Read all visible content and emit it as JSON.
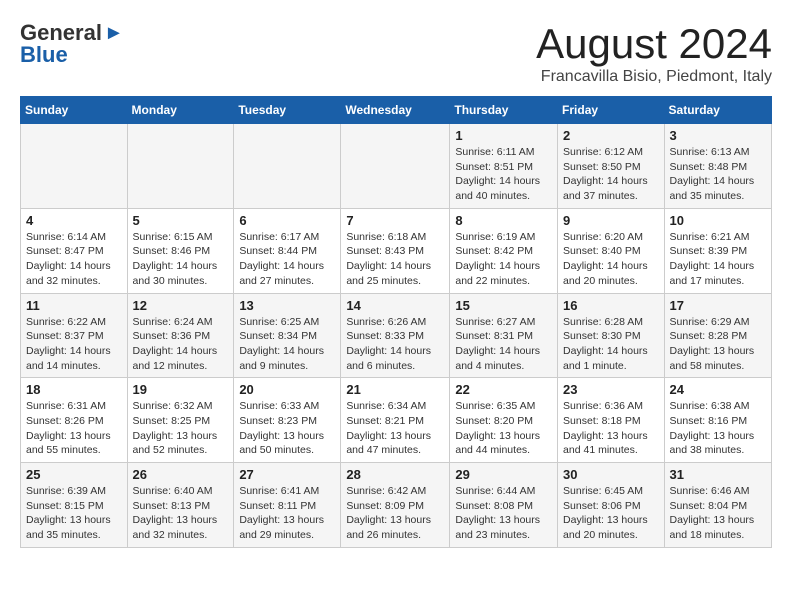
{
  "logo": {
    "general": "General",
    "blue": "Blue"
  },
  "title": "August 2024",
  "location": "Francavilla Bisio, Piedmont, Italy",
  "weekdays": [
    "Sunday",
    "Monday",
    "Tuesday",
    "Wednesday",
    "Thursday",
    "Friday",
    "Saturday"
  ],
  "weeks": [
    [
      {
        "day": "",
        "content": ""
      },
      {
        "day": "",
        "content": ""
      },
      {
        "day": "",
        "content": ""
      },
      {
        "day": "",
        "content": ""
      },
      {
        "day": "1",
        "content": "Sunrise: 6:11 AM\nSunset: 8:51 PM\nDaylight: 14 hours and 40 minutes."
      },
      {
        "day": "2",
        "content": "Sunrise: 6:12 AM\nSunset: 8:50 PM\nDaylight: 14 hours and 37 minutes."
      },
      {
        "day": "3",
        "content": "Sunrise: 6:13 AM\nSunset: 8:48 PM\nDaylight: 14 hours and 35 minutes."
      }
    ],
    [
      {
        "day": "4",
        "content": "Sunrise: 6:14 AM\nSunset: 8:47 PM\nDaylight: 14 hours and 32 minutes."
      },
      {
        "day": "5",
        "content": "Sunrise: 6:15 AM\nSunset: 8:46 PM\nDaylight: 14 hours and 30 minutes."
      },
      {
        "day": "6",
        "content": "Sunrise: 6:17 AM\nSunset: 8:44 PM\nDaylight: 14 hours and 27 minutes."
      },
      {
        "day": "7",
        "content": "Sunrise: 6:18 AM\nSunset: 8:43 PM\nDaylight: 14 hours and 25 minutes."
      },
      {
        "day": "8",
        "content": "Sunrise: 6:19 AM\nSunset: 8:42 PM\nDaylight: 14 hours and 22 minutes."
      },
      {
        "day": "9",
        "content": "Sunrise: 6:20 AM\nSunset: 8:40 PM\nDaylight: 14 hours and 20 minutes."
      },
      {
        "day": "10",
        "content": "Sunrise: 6:21 AM\nSunset: 8:39 PM\nDaylight: 14 hours and 17 minutes."
      }
    ],
    [
      {
        "day": "11",
        "content": "Sunrise: 6:22 AM\nSunset: 8:37 PM\nDaylight: 14 hours and 14 minutes."
      },
      {
        "day": "12",
        "content": "Sunrise: 6:24 AM\nSunset: 8:36 PM\nDaylight: 14 hours and 12 minutes."
      },
      {
        "day": "13",
        "content": "Sunrise: 6:25 AM\nSunset: 8:34 PM\nDaylight: 14 hours and 9 minutes."
      },
      {
        "day": "14",
        "content": "Sunrise: 6:26 AM\nSunset: 8:33 PM\nDaylight: 14 hours and 6 minutes."
      },
      {
        "day": "15",
        "content": "Sunrise: 6:27 AM\nSunset: 8:31 PM\nDaylight: 14 hours and 4 minutes."
      },
      {
        "day": "16",
        "content": "Sunrise: 6:28 AM\nSunset: 8:30 PM\nDaylight: 14 hours and 1 minute."
      },
      {
        "day": "17",
        "content": "Sunrise: 6:29 AM\nSunset: 8:28 PM\nDaylight: 13 hours and 58 minutes."
      }
    ],
    [
      {
        "day": "18",
        "content": "Sunrise: 6:31 AM\nSunset: 8:26 PM\nDaylight: 13 hours and 55 minutes."
      },
      {
        "day": "19",
        "content": "Sunrise: 6:32 AM\nSunset: 8:25 PM\nDaylight: 13 hours and 52 minutes."
      },
      {
        "day": "20",
        "content": "Sunrise: 6:33 AM\nSunset: 8:23 PM\nDaylight: 13 hours and 50 minutes."
      },
      {
        "day": "21",
        "content": "Sunrise: 6:34 AM\nSunset: 8:21 PM\nDaylight: 13 hours and 47 minutes."
      },
      {
        "day": "22",
        "content": "Sunrise: 6:35 AM\nSunset: 8:20 PM\nDaylight: 13 hours and 44 minutes."
      },
      {
        "day": "23",
        "content": "Sunrise: 6:36 AM\nSunset: 8:18 PM\nDaylight: 13 hours and 41 minutes."
      },
      {
        "day": "24",
        "content": "Sunrise: 6:38 AM\nSunset: 8:16 PM\nDaylight: 13 hours and 38 minutes."
      }
    ],
    [
      {
        "day": "25",
        "content": "Sunrise: 6:39 AM\nSunset: 8:15 PM\nDaylight: 13 hours and 35 minutes."
      },
      {
        "day": "26",
        "content": "Sunrise: 6:40 AM\nSunset: 8:13 PM\nDaylight: 13 hours and 32 minutes."
      },
      {
        "day": "27",
        "content": "Sunrise: 6:41 AM\nSunset: 8:11 PM\nDaylight: 13 hours and 29 minutes."
      },
      {
        "day": "28",
        "content": "Sunrise: 6:42 AM\nSunset: 8:09 PM\nDaylight: 13 hours and 26 minutes."
      },
      {
        "day": "29",
        "content": "Sunrise: 6:44 AM\nSunset: 8:08 PM\nDaylight: 13 hours and 23 minutes."
      },
      {
        "day": "30",
        "content": "Sunrise: 6:45 AM\nSunset: 8:06 PM\nDaylight: 13 hours and 20 minutes."
      },
      {
        "day": "31",
        "content": "Sunrise: 6:46 AM\nSunset: 8:04 PM\nDaylight: 13 hours and 18 minutes."
      }
    ]
  ]
}
